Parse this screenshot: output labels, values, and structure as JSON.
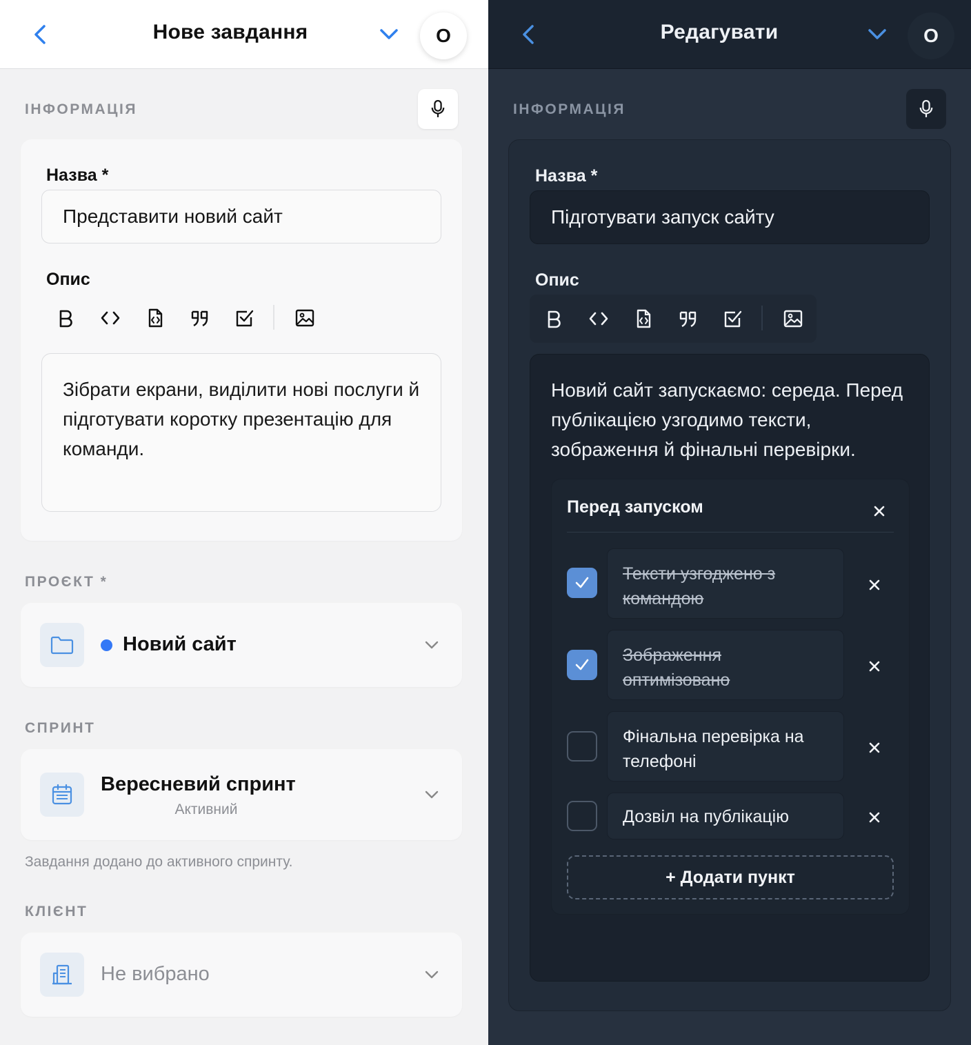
{
  "left": {
    "header": {
      "title": "Нове завдання",
      "avatar": "O"
    },
    "info_section": "ІНФОРМАЦІЯ",
    "name_label": "Назва *",
    "name_value": "Представити новий сайт",
    "desc_label": "Опис",
    "toolbar": [
      "bold-icon",
      "code-icon",
      "code-block-icon",
      "quote-icon",
      "checklist-icon",
      "image-icon"
    ],
    "description": "Зібрати екрани, виділити нові послуги й підготувати коротку презентацію для команди.",
    "project_section": "ПРОЄКТ *",
    "project_value": "Новий сайт",
    "project_dot_color": "#3478f6",
    "sprint_section": "СПРИНТ",
    "sprint_value": "Вересневий спринт",
    "sprint_status": "Активний",
    "sprint_hint": "Завдання додано до активного спринту.",
    "client_section": "КЛІЄНТ",
    "client_value": "Не вибрано"
  },
  "right": {
    "header": {
      "title": "Редагувати",
      "avatar": "O"
    },
    "info_section": "ІНФОРМАЦІЯ",
    "name_label": "Назва *",
    "name_value": "Підготувати запуск сайту",
    "desc_label": "Опис",
    "description": "Новий сайт запускаємо: середа. Перед публікацією узгодимо тексти, зображення й фінальні перевірки.",
    "checklist": {
      "title": "Перед запуском",
      "items": [
        {
          "text": "Тексти узгоджено з командою",
          "checked": true
        },
        {
          "text": "Зображення оптимізовано",
          "checked": true
        },
        {
          "text": "Фінальна перевірка на телефоні",
          "checked": false
        },
        {
          "text": "Дозвіл на публікацію",
          "checked": false
        }
      ],
      "add_label": "+ Додати пункт"
    }
  },
  "colors": {
    "accent": "#2f80ed",
    "accent_dark": "#4a90e2",
    "check_on": "#5b8fd6"
  }
}
